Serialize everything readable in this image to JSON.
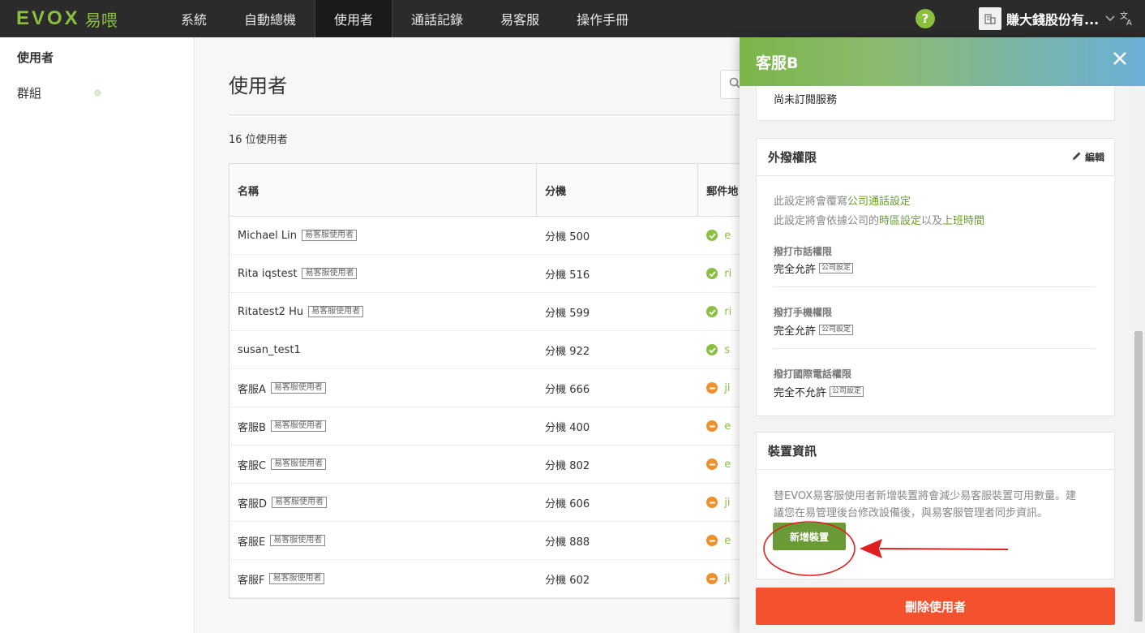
{
  "nav": {
    "logo_en": "EVOX",
    "logo_zh": "易喂",
    "items": [
      "系統",
      "自動總機",
      "使用者",
      "通話記錄",
      "易客服",
      "操作手冊"
    ],
    "active": "使用者",
    "help": "?",
    "company": "賺大錢股份有...",
    "lang_icon": "文A"
  },
  "sidebar": {
    "items": [
      "使用者",
      "群組"
    ]
  },
  "main": {
    "title": "使用者",
    "search_icon": "Q",
    "user_count": "16 位使用者",
    "columns": [
      "名稱",
      "分機",
      "郵件地"
    ],
    "rows": [
      {
        "name": "Michael Lin",
        "tag": "易客服使用者",
        "ext": "分機 500",
        "status": "ok",
        "email": "e"
      },
      {
        "name": "Rita iqstest",
        "tag": "易客服使用者",
        "ext": "分機 516",
        "status": "ok",
        "email": "ri"
      },
      {
        "name": "Ritatest2 Hu",
        "tag": "易客服使用者",
        "ext": "分機 599",
        "status": "ok",
        "email": "ri"
      },
      {
        "name": "susan_test1",
        "tag": "",
        "ext": "分機 922",
        "status": "ok",
        "email": "s"
      },
      {
        "name": "客服A",
        "tag": "易客服使用者",
        "ext": "分機 666",
        "status": "warn",
        "email": "ji"
      },
      {
        "name": "客服B",
        "tag": "易客服使用者",
        "ext": "分機 400",
        "status": "warn",
        "email": "e"
      },
      {
        "name": "客服C",
        "tag": "易客服使用者",
        "ext": "分機 802",
        "status": "warn",
        "email": "e"
      },
      {
        "name": "客服D",
        "tag": "易客服使用者",
        "ext": "分機 606",
        "status": "warn",
        "email": "ji"
      },
      {
        "name": "客服E",
        "tag": "易客服使用者",
        "ext": "分機 888",
        "status": "warn",
        "email": "e"
      },
      {
        "name": "客服F",
        "tag": "易客服使用者",
        "ext": "分機 602",
        "status": "warn",
        "email": "ji"
      }
    ]
  },
  "drawer": {
    "title": "客服B",
    "close": "✕",
    "subscription_text": "尚未訂閱服務",
    "outbound": {
      "title": "外撥權限",
      "edit": "編輯",
      "note1_prefix": "此設定將會覆寫",
      "note1_link": "公司通話設定",
      "note2_prefix": "此設定將會依據公司的",
      "note2_link1": "時區設定",
      "note2_mid": "以及",
      "note2_link2": "上班時間",
      "perms": [
        {
          "label": "撥打市話權限",
          "value": "完全允許",
          "tag": "公司設定"
        },
        {
          "label": "撥打手機權限",
          "value": "完全允許",
          "tag": "公司設定"
        },
        {
          "label": "撥打國際電話權限",
          "value": "完全不允許",
          "tag": "公司設定"
        }
      ]
    },
    "device": {
      "title": "裝置資訊",
      "line1": "替EVOX易客服使用者新增裝置將會減少易客服裝置可用數量。建",
      "line2": "議您在易管理後台修改設備後，與易客服管理者同步資訊。",
      "add_button": "新增裝置"
    },
    "delete_button": "刪除使用者"
  },
  "colors": {
    "brand_green": "#8bbf3f",
    "button_green": "#6a9a36",
    "delete_red": "#f4522f",
    "annotation_red": "#e02020"
  }
}
